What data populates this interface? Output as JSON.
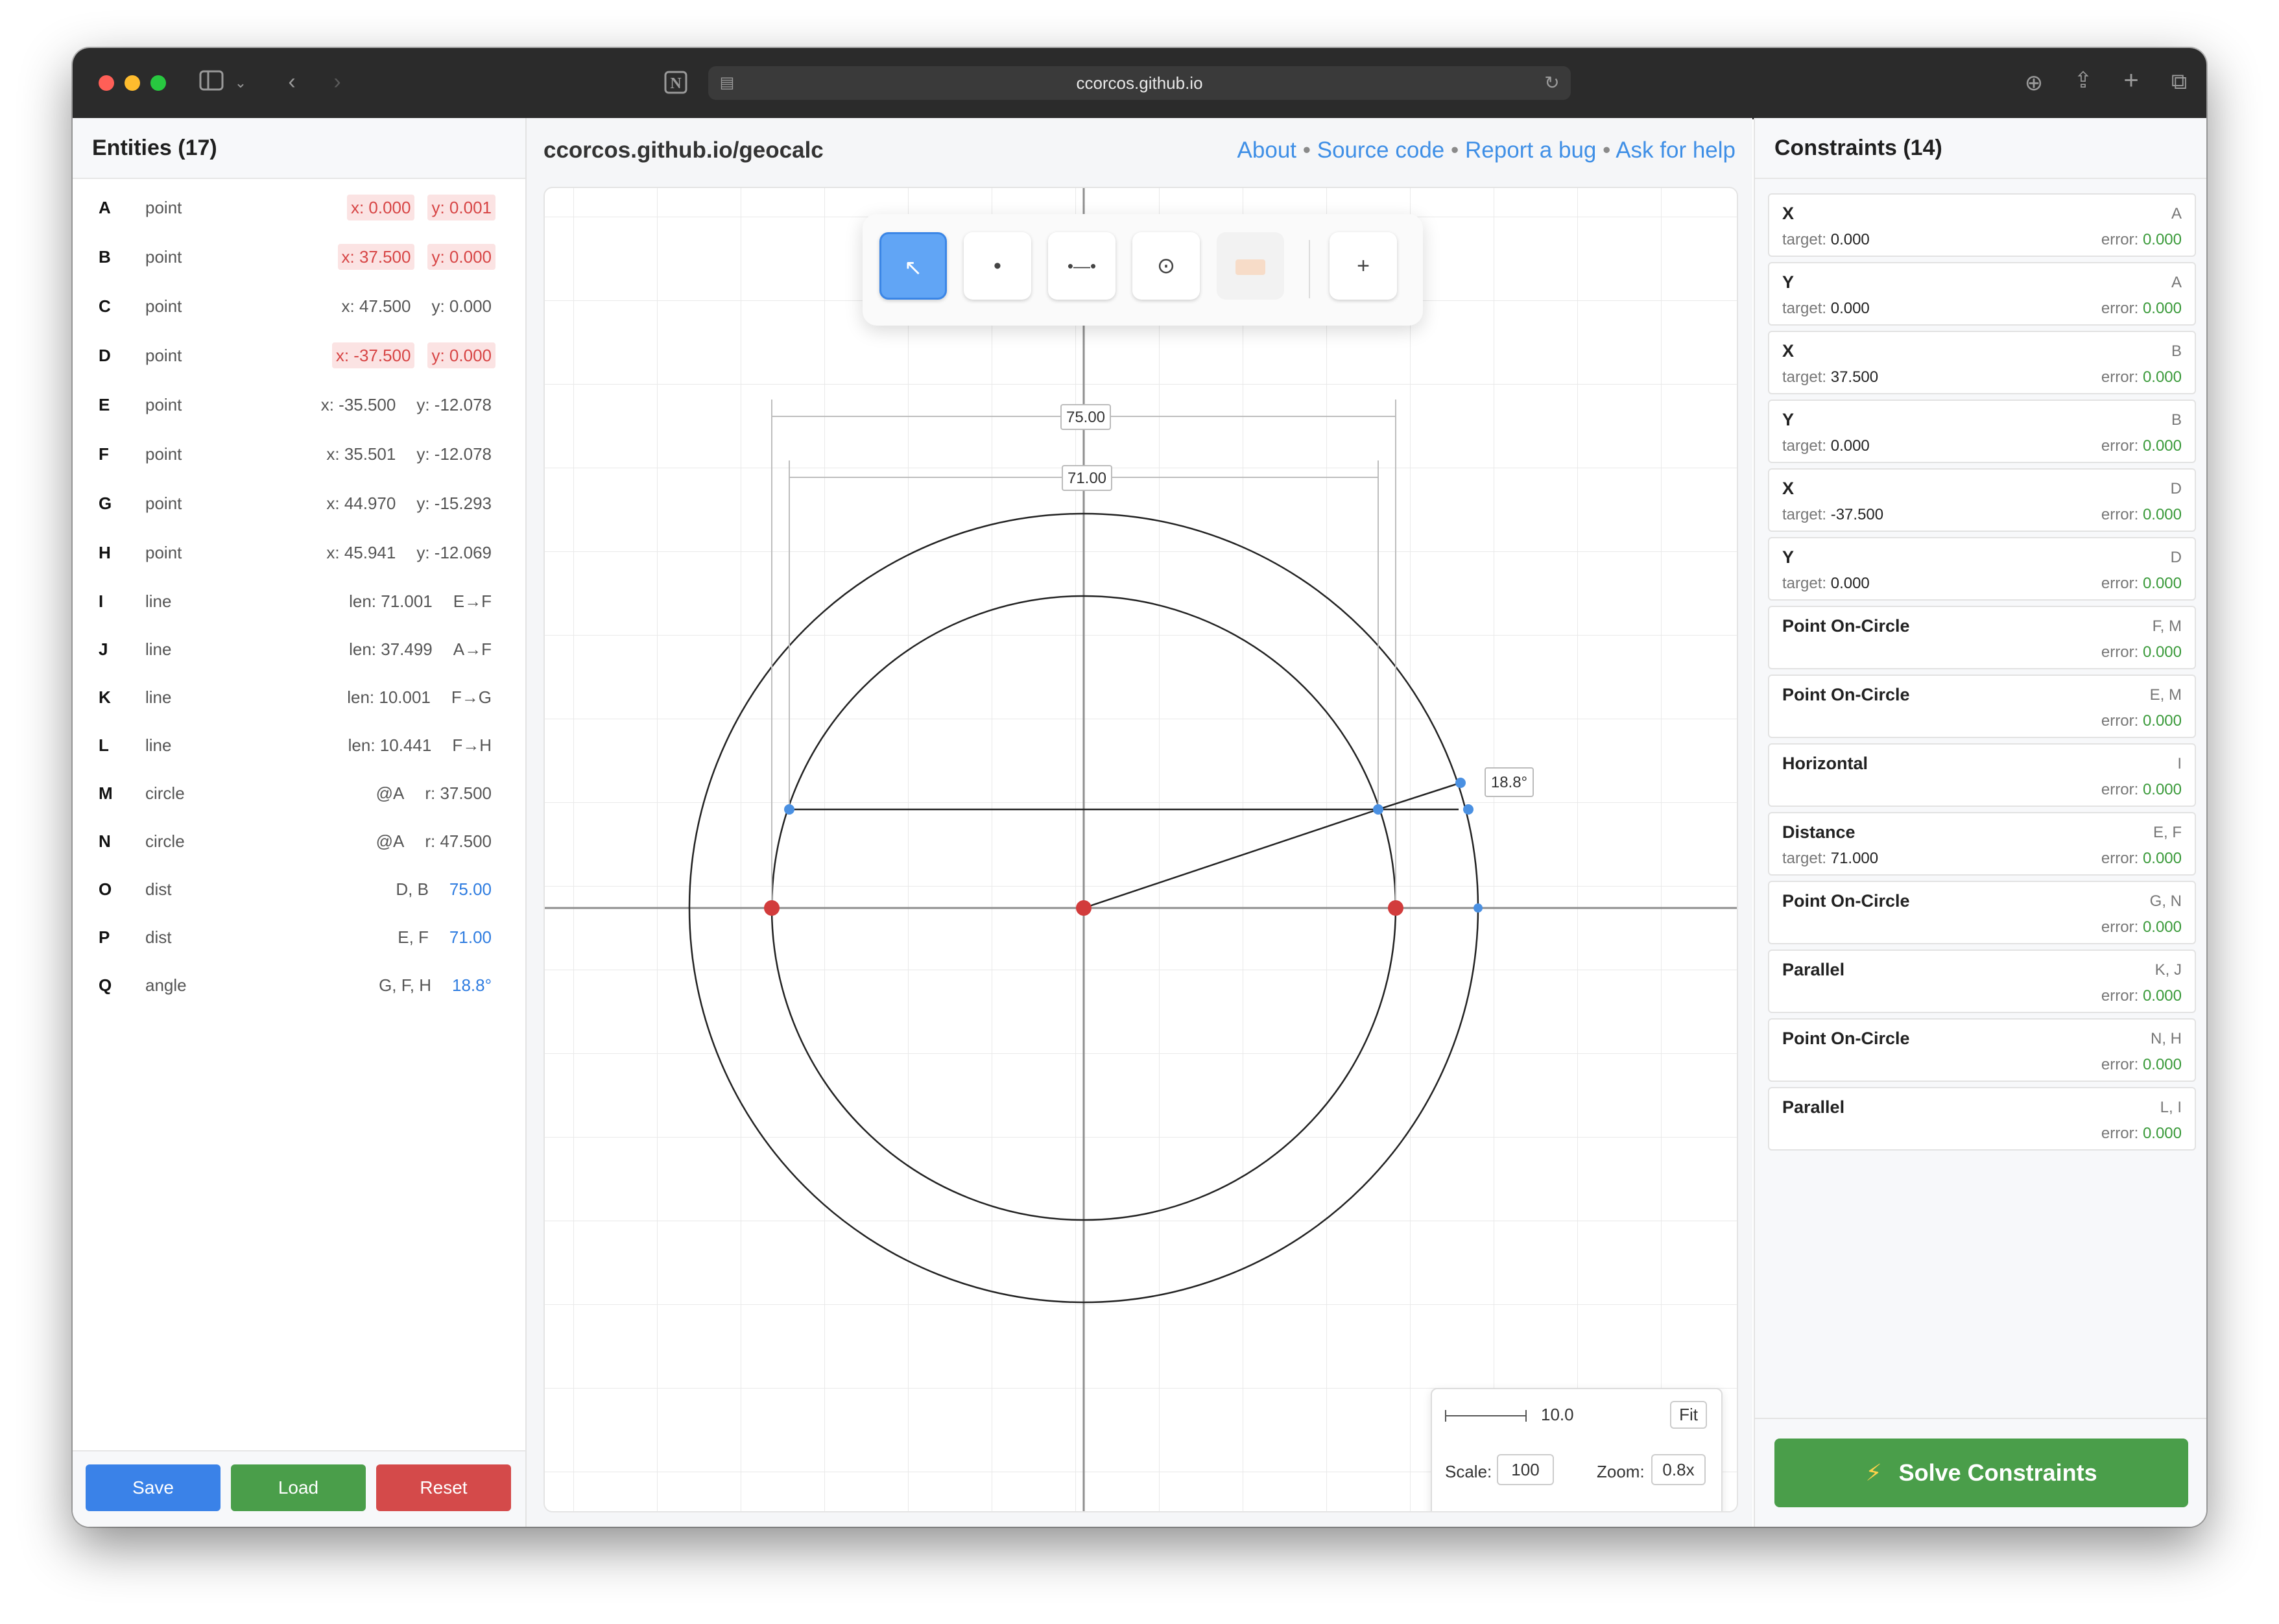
{
  "browser": {
    "url": "ccorcos.github.io"
  },
  "left_panel": {
    "title": "Entities (17)",
    "entities": [
      {
        "id": "A",
        "type": "point",
        "vals": [
          {
            "t": "x: 0.000",
            "k": "err"
          },
          {
            "t": "y: 0.001",
            "k": "err"
          }
        ]
      },
      {
        "id": "B",
        "type": "point",
        "vals": [
          {
            "t": "x: 37.500",
            "k": "err"
          },
          {
            "t": "y: 0.000",
            "k": "err"
          }
        ]
      },
      {
        "id": "C",
        "type": "point",
        "vals": [
          {
            "t": "x: 47.500",
            "k": "plain"
          },
          {
            "t": "y: 0.000",
            "k": "plain"
          }
        ]
      },
      {
        "id": "D",
        "type": "point",
        "vals": [
          {
            "t": "x: -37.500",
            "k": "err"
          },
          {
            "t": "y: 0.000",
            "k": "err"
          }
        ]
      },
      {
        "id": "E",
        "type": "point",
        "vals": [
          {
            "t": "x: -35.500",
            "k": "plain"
          },
          {
            "t": "y: -12.078",
            "k": "plain"
          }
        ]
      },
      {
        "id": "F",
        "type": "point",
        "vals": [
          {
            "t": "x: 35.501",
            "k": "plain"
          },
          {
            "t": "y: -12.078",
            "k": "plain"
          }
        ]
      },
      {
        "id": "G",
        "type": "point",
        "vals": [
          {
            "t": "x: 44.970",
            "k": "plain"
          },
          {
            "t": "y: -15.293",
            "k": "plain"
          }
        ]
      },
      {
        "id": "H",
        "type": "point",
        "vals": [
          {
            "t": "x: 45.941",
            "k": "plain"
          },
          {
            "t": "y: -12.069",
            "k": "plain"
          }
        ]
      },
      {
        "id": "I",
        "type": "line",
        "vals": [
          {
            "t": "len: 71.001",
            "k": "plain"
          },
          {
            "t": "E→F",
            "k": "plain"
          }
        ]
      },
      {
        "id": "J",
        "type": "line",
        "vals": [
          {
            "t": "len: 37.499",
            "k": "plain"
          },
          {
            "t": "A→F",
            "k": "plain"
          }
        ]
      },
      {
        "id": "K",
        "type": "line",
        "vals": [
          {
            "t": "len: 10.001",
            "k": "plain"
          },
          {
            "t": "F→G",
            "k": "plain"
          }
        ]
      },
      {
        "id": "L",
        "type": "line",
        "vals": [
          {
            "t": "len: 10.441",
            "k": "plain"
          },
          {
            "t": "F→H",
            "k": "plain"
          }
        ]
      },
      {
        "id": "M",
        "type": "circle",
        "vals": [
          {
            "t": "@A",
            "k": "plain"
          },
          {
            "t": "r: 37.500",
            "k": "plain"
          }
        ]
      },
      {
        "id": "N",
        "type": "circle",
        "vals": [
          {
            "t": "@A",
            "k": "plain"
          },
          {
            "t": "r: 47.500",
            "k": "plain"
          }
        ]
      },
      {
        "id": "O",
        "type": "dist",
        "vals": [
          {
            "t": "D, B",
            "k": "plain"
          },
          {
            "t": "75.00",
            "k": "blue"
          }
        ]
      },
      {
        "id": "P",
        "type": "dist",
        "vals": [
          {
            "t": "E, F",
            "k": "plain"
          },
          {
            "t": "71.00",
            "k": "blue"
          }
        ]
      },
      {
        "id": "Q",
        "type": "angle",
        "vals": [
          {
            "t": "G, F, H",
            "k": "plain"
          },
          {
            "t": "18.8°",
            "k": "blue"
          }
        ]
      }
    ],
    "buttons": {
      "save": "Save",
      "load": "Load",
      "reset": "Reset"
    }
  },
  "center": {
    "title": "ccorcos.github.io/geocalc",
    "links": [
      "About",
      "Source code",
      "Report a bug",
      "Ask for help"
    ],
    "separator": "•",
    "toolbar": {
      "tools": [
        {
          "name": "select-tool",
          "glyph": "↖",
          "state": "active"
        },
        {
          "name": "point-tool",
          "glyph": "•",
          "state": "normal"
        },
        {
          "name": "line-tool",
          "glyph": "•—•",
          "state": "normal"
        },
        {
          "name": "circle-tool",
          "glyph": "⊙",
          "state": "normal"
        },
        {
          "name": "label-tool",
          "glyph": "",
          "state": "disabled"
        },
        {
          "name": "add-tool",
          "glyph": "+",
          "state": "normal"
        }
      ]
    },
    "canvas": {
      "dim_labels": [
        "75.00",
        "71.00"
      ],
      "angle_label": "18.8°"
    },
    "scale_box": {
      "bar_value": "10.0",
      "fit_label": "Fit",
      "scale_label": "Scale:",
      "scale_value": "100",
      "zoom_label": "Zoom:",
      "zoom_value": "0.8x"
    }
  },
  "right_panel": {
    "title": "Constraints (14)",
    "constraints": [
      {
        "title": "X",
        "ents": "A",
        "target": "0.000",
        "error": "0.000"
      },
      {
        "title": "Y",
        "ents": "A",
        "target": "0.000",
        "error": "0.000"
      },
      {
        "title": "X",
        "ents": "B",
        "target": "37.500",
        "error": "0.000"
      },
      {
        "title": "Y",
        "ents": "B",
        "target": "0.000",
        "error": "0.000"
      },
      {
        "title": "X",
        "ents": "D",
        "target": "-37.500",
        "error": "0.000"
      },
      {
        "title": "Y",
        "ents": "D",
        "target": "0.000",
        "error": "0.000"
      },
      {
        "title": "Point On-Circle",
        "ents": "F, M",
        "target": null,
        "error": "0.000"
      },
      {
        "title": "Point On-Circle",
        "ents": "E, M",
        "target": null,
        "error": "0.000"
      },
      {
        "title": "Horizontal",
        "ents": "I",
        "target": null,
        "error": "0.000"
      },
      {
        "title": "Distance",
        "ents": "E, F",
        "target": "71.000",
        "error": "0.000"
      },
      {
        "title": "Point On-Circle",
        "ents": "G, N",
        "target": null,
        "error": "0.000"
      },
      {
        "title": "Parallel",
        "ents": "K, J",
        "target": null,
        "error": "0.000"
      },
      {
        "title": "Point On-Circle",
        "ents": "N, H",
        "target": null,
        "error": "0.000"
      },
      {
        "title": "Parallel",
        "ents": "L, I",
        "target": null,
        "error": "0.000"
      }
    ],
    "target_label": "target:",
    "error_label": "error:",
    "solve_label": "Solve Constraints",
    "solve_icon": "⚡"
  },
  "colors": {
    "point_fixed": "#d23c3c",
    "point_free": "#4a90e2",
    "accent_blue": "#3f8fe6",
    "ok_green": "#3a9a3a"
  }
}
